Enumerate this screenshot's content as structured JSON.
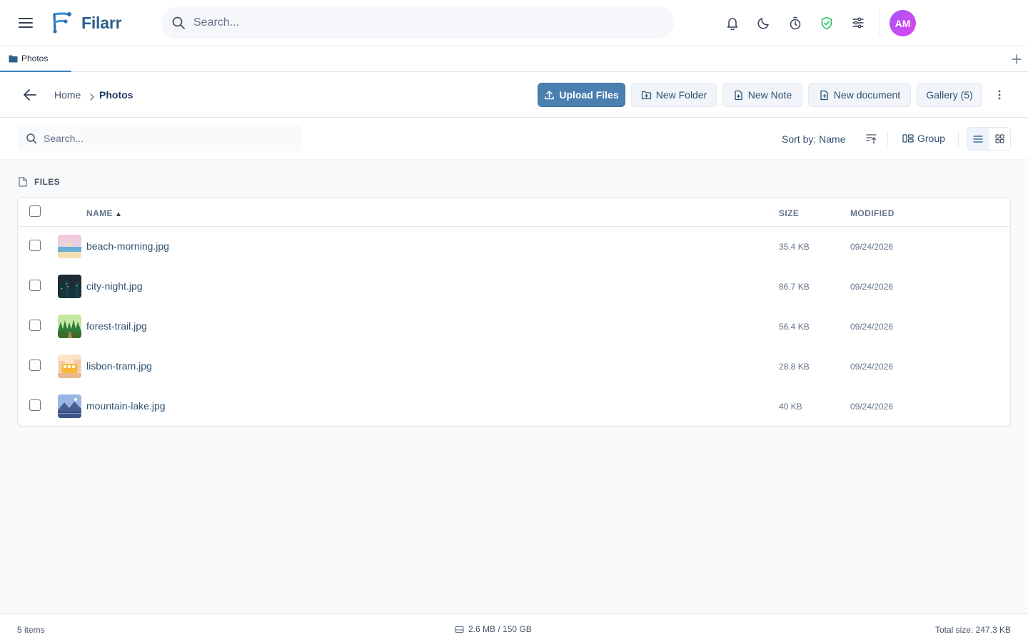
{
  "app": {
    "brand": "Filarr",
    "user_initials": "AM"
  },
  "header": {
    "search_placeholder": "Search...",
    "icons": [
      "menu-icon",
      "bell-icon",
      "moon-icon",
      "timer-icon",
      "shield-check-icon",
      "sliders-icon"
    ]
  },
  "tabs": [
    {
      "label": "Photos",
      "icon": "folder-icon",
      "active": true
    }
  ],
  "breadcrumb": {
    "home": "Home",
    "current": "Photos"
  },
  "actions": {
    "upload": "Upload Files",
    "new_folder": "New Folder",
    "new_note": "New Note",
    "new_document": "New document",
    "gallery": "Gallery (5)"
  },
  "filter": {
    "search_placeholder": "Search...",
    "sort_label": "Sort by: Name",
    "group_label": "Group",
    "view_mode": "list"
  },
  "section": {
    "label": "FILES"
  },
  "table": {
    "columns": {
      "name": "NAME",
      "size": "SIZE",
      "modified": "MODIFIED"
    },
    "sort_column": "name",
    "sort_direction": "ascending",
    "rows": [
      {
        "name": "beach-morning.jpg",
        "size": "35.4 KB",
        "modified": "09/24/2026",
        "thumb": "beach"
      },
      {
        "name": "city-night.jpg",
        "size": "86.7 KB",
        "modified": "09/24/2026",
        "thumb": "city"
      },
      {
        "name": "forest-trail.jpg",
        "size": "56.4 KB",
        "modified": "09/24/2026",
        "thumb": "forest"
      },
      {
        "name": "lisbon-tram.jpg",
        "size": "28.8 KB",
        "modified": "09/24/2026",
        "thumb": "tram"
      },
      {
        "name": "mountain-lake.jpg",
        "size": "40 KB",
        "modified": "09/24/2026",
        "thumb": "mountain"
      }
    ]
  },
  "status": {
    "items": "5 items",
    "storage": "2.6 MB / 150 GB",
    "total": "Total size: 247.3 KB"
  },
  "colors": {
    "primary": "#4a7fb0",
    "brand": "#2f5f8a",
    "shield": "#22c55e",
    "avatar_from": "#a855f7",
    "avatar_to": "#d946ef"
  }
}
